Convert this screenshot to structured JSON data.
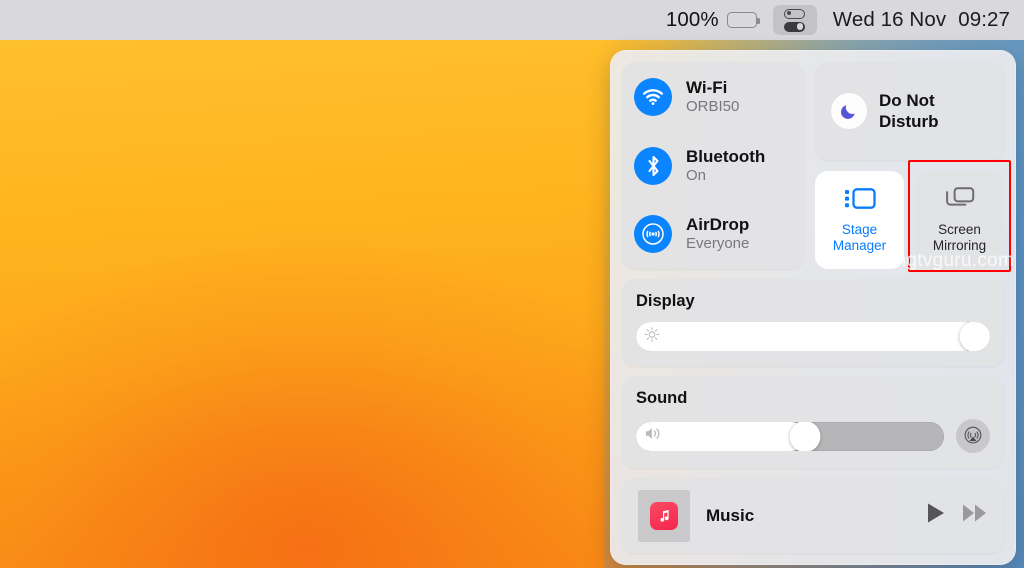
{
  "menubar": {
    "battery_percent": "100%",
    "battery_icon": "battery-full-icon",
    "control_center_icon": "control-center-toggles-icon",
    "day_date": "Wed 16 Nov",
    "time": "09:27"
  },
  "control_center": {
    "connectivity": [
      {
        "icon": "wifi-icon",
        "title": "Wi-Fi",
        "status": "ORBI50"
      },
      {
        "icon": "bluetooth-icon",
        "title": "Bluetooth",
        "status": "On"
      },
      {
        "icon": "airdrop-icon",
        "title": "AirDrop",
        "status": "Everyone"
      }
    ],
    "do_not_disturb": {
      "icon": "moon-icon",
      "label": "Do Not\nDisturb",
      "line1": "Do Not",
      "line2": "Disturb"
    },
    "tiles": [
      {
        "id": "stage-manager",
        "icon": "stage-manager-icon",
        "line1": "Stage",
        "line2": "Manager",
        "active": true
      },
      {
        "id": "screen-mirroring",
        "icon": "screen-mirroring-icon",
        "line1": "Screen",
        "line2": "Mirroring",
        "active": false,
        "highlighted": true
      }
    ],
    "display": {
      "title": "Display",
      "icon": "brightness-icon",
      "value": 97
    },
    "sound": {
      "title": "Sound",
      "icon": "speaker-volume-icon",
      "value": 55,
      "airplay_icon": "airplay-audio-icon"
    },
    "now_playing": {
      "app_icon": "music-app-icon",
      "title": "Music",
      "play_icon": "play-icon",
      "next_icon": "fast-forward-icon"
    }
  },
  "colors": {
    "accent_blue": "#0a84ff",
    "stage_manager_blue": "#0a7cff",
    "highlight_red": "#ff0000",
    "battery_green": "#32d732",
    "moon_purple": "#5856d6",
    "music_red": "#f4264e"
  },
  "watermark": {
    "text": "samsungtvguru.com"
  }
}
